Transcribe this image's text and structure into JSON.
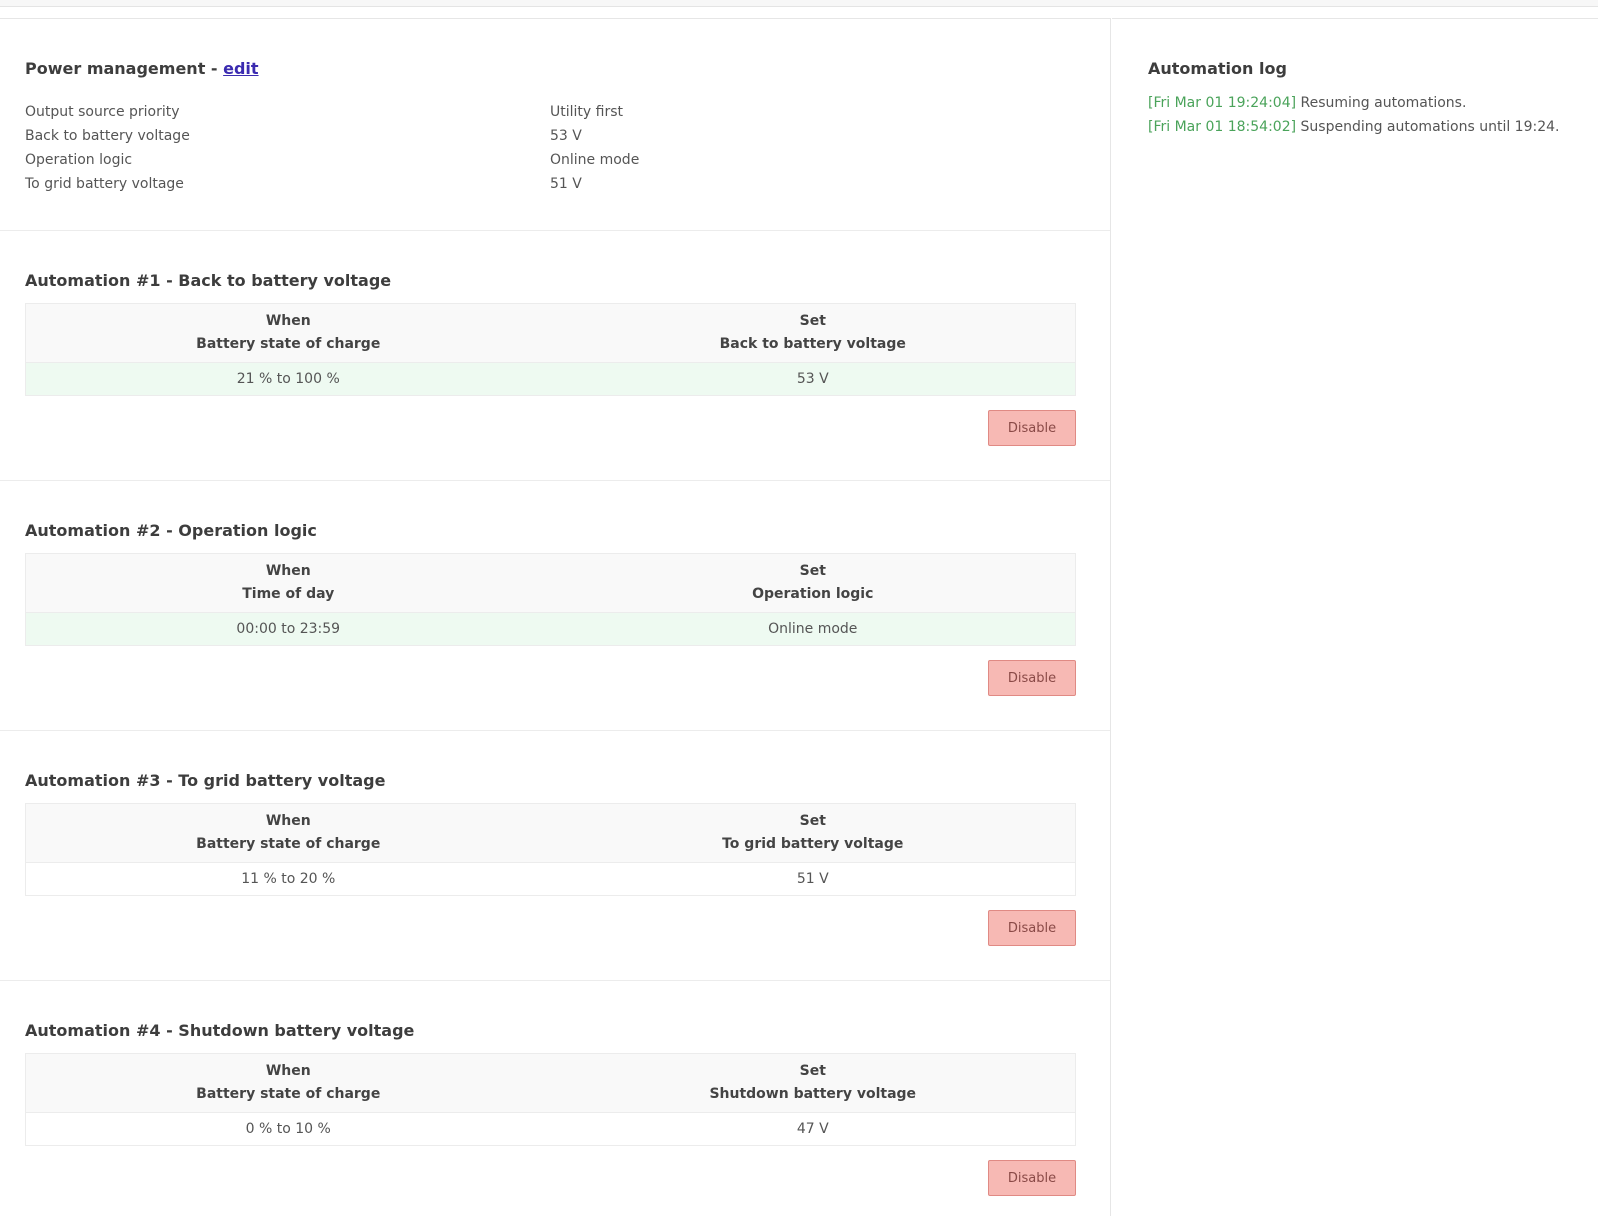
{
  "power": {
    "title_prefix": "Power management - ",
    "edit_label": "edit",
    "settings": [
      {
        "label": "Output source priority",
        "value": "Utility first"
      },
      {
        "label": "Back to battery voltage",
        "value": "53 V"
      },
      {
        "label": "Operation logic",
        "value": "Online mode"
      },
      {
        "label": "To grid battery voltage",
        "value": "51 V"
      }
    ]
  },
  "automations": [
    {
      "title": "Automation #1 - Back to battery voltage",
      "when_header": "When",
      "when_sub": "Battery state of charge",
      "set_header": "Set",
      "set_sub": "Back to battery voltage",
      "when_value": "21 % to 100 %",
      "set_value": "53 V",
      "active": true,
      "button": "Disable"
    },
    {
      "title": "Automation #2 - Operation logic",
      "when_header": "When",
      "when_sub": "Time of day",
      "set_header": "Set",
      "set_sub": "Operation logic",
      "when_value": "00:00 to 23:59",
      "set_value": "Online mode",
      "active": true,
      "button": "Disable"
    },
    {
      "title": "Automation #3 - To grid battery voltage",
      "when_header": "When",
      "when_sub": "Battery state of charge",
      "set_header": "Set",
      "set_sub": "To grid battery voltage",
      "when_value": "11 % to 20 %",
      "set_value": "51 V",
      "active": false,
      "button": "Disable"
    },
    {
      "title": "Automation #4 - Shutdown battery voltage",
      "when_header": "When",
      "when_sub": "Battery state of charge",
      "set_header": "Set",
      "set_sub": "Shutdown battery voltage",
      "when_value": "0 % to 10 %",
      "set_value": "47 V",
      "active": false,
      "button": "Disable"
    }
  ],
  "log": {
    "title": "Automation log",
    "entries": [
      {
        "time": "[Fri Mar 01 19:24:04]",
        "message": " Resuming automations."
      },
      {
        "time": "[Fri Mar 01 18:54:02]",
        "message": " Suspending automations until 19:24."
      }
    ]
  },
  "colors": {
    "active_row": "#eefaf1",
    "timestamp": "#4aa35a",
    "disable_button": "#f7b9b4",
    "link": "#3b2bb0"
  }
}
